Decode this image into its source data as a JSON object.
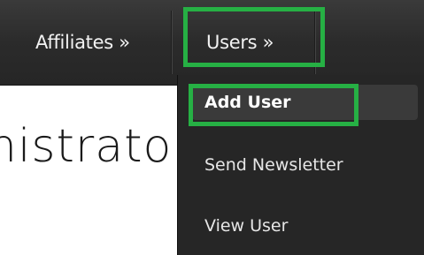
{
  "navbar": {
    "items": [
      {
        "label": "Affiliates »"
      },
      {
        "label": "Users »"
      }
    ]
  },
  "content": {
    "welcome_fragment": "nistrator!"
  },
  "dropdown": {
    "items": [
      {
        "label": "Add User"
      },
      {
        "label": "Send Newsletter"
      },
      {
        "label": "View User"
      }
    ]
  },
  "colors": {
    "navbar_bg": "#2b2b2b",
    "dropdown_bg": "#262626",
    "highlight": "#26b044",
    "text_light": "#f2f2f2"
  }
}
